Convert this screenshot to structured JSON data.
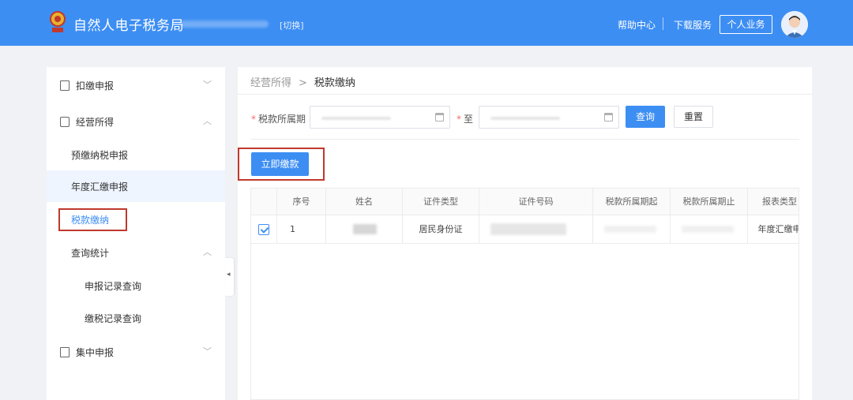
{
  "header": {
    "title": "自然人电子税务局",
    "switch_label": "[切换]",
    "help_center": "帮助中心",
    "download_service": "下载服务",
    "personal_business": "个人业务"
  },
  "sidebar": {
    "items": [
      {
        "label": "扣缴申报",
        "icon": "form-icon",
        "expanded": false
      },
      {
        "label": "经营所得",
        "icon": "business-icon",
        "expanded": true,
        "children": [
          {
            "label": "预缴纳税申报"
          },
          {
            "label": "年度汇缴申报"
          },
          {
            "label": "税款缴纳"
          },
          {
            "label": "查询统计",
            "children": [
              {
                "label": "申报记录查询"
              },
              {
                "label": "缴税记录查询"
              }
            ]
          }
        ]
      },
      {
        "label": "集中申报",
        "icon": "batch-icon",
        "expanded": false
      }
    ]
  },
  "breadcrumb": {
    "parent": "经营所得",
    "separator": ">",
    "current": "税款缴纳"
  },
  "filter": {
    "period_label": "税款所属期",
    "to_label": "至",
    "query_button": "查询",
    "reset_button": "重置"
  },
  "actions": {
    "pay_now": "立即缴款"
  },
  "table": {
    "columns": [
      "序号",
      "姓名",
      "证件类型",
      "证件号码",
      "税款所属期起",
      "税款所属期止",
      "报表类型"
    ],
    "rows": [
      {
        "checked": true,
        "index": "1",
        "id_type": "居民身份证",
        "report_type": "年度汇缴申"
      }
    ]
  },
  "colors": {
    "primary": "#3d8ef3",
    "highlight_frame": "#c0392b",
    "required_mark": "#f56c6c"
  }
}
